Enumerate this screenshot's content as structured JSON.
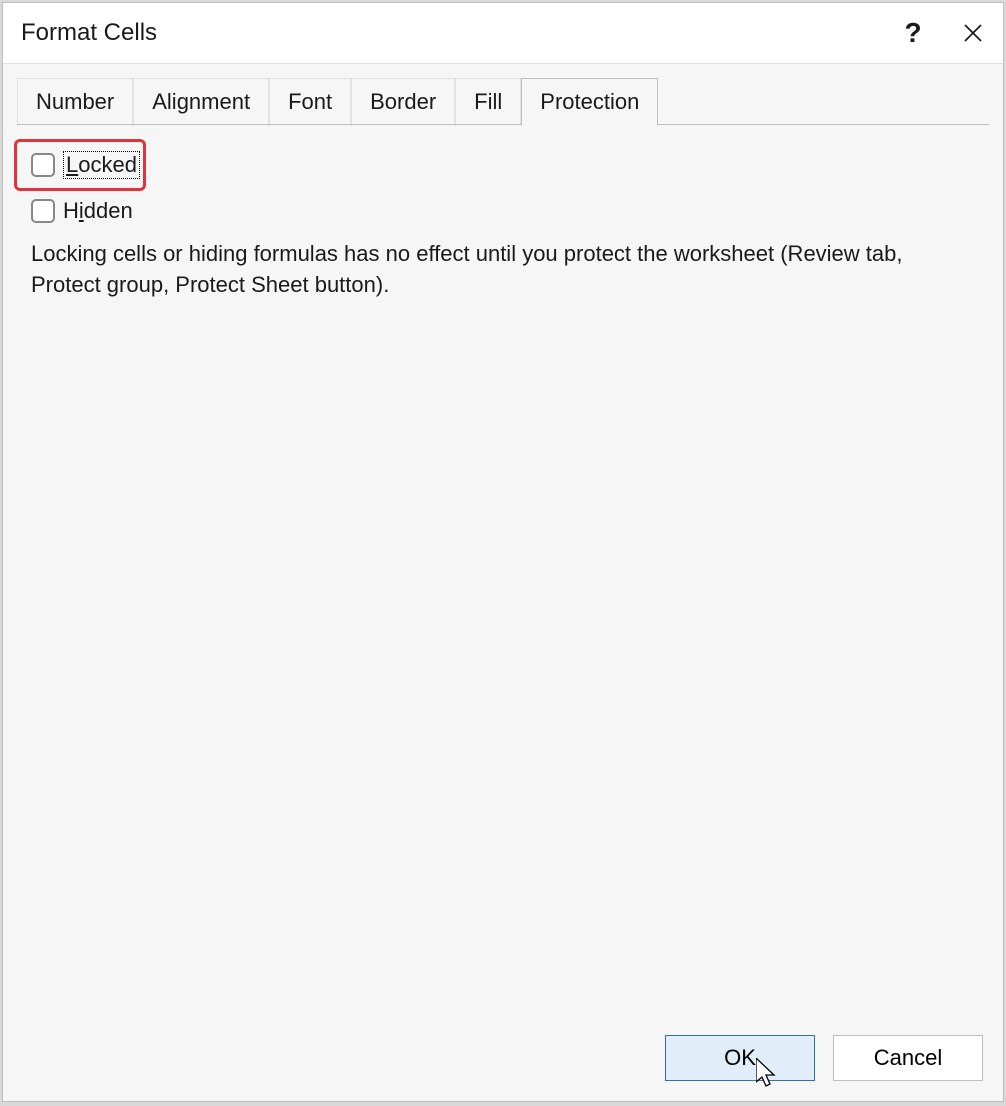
{
  "dialog": {
    "title": "Format Cells"
  },
  "tabs": {
    "number": "Number",
    "alignment": "Alignment",
    "font": "Font",
    "border": "Border",
    "fill": "Fill",
    "protection": "Protection"
  },
  "protection": {
    "locked_prefix": "L",
    "locked_rest": "ocked",
    "hidden_prefix": "H",
    "hidden_mnemonic": "i",
    "hidden_rest": "dden",
    "help_text": "Locking cells or hiding formulas has no effect until you protect the worksheet (Review tab, Protect group, Protect Sheet button)."
  },
  "buttons": {
    "ok": "OK",
    "cancel": "Cancel"
  }
}
